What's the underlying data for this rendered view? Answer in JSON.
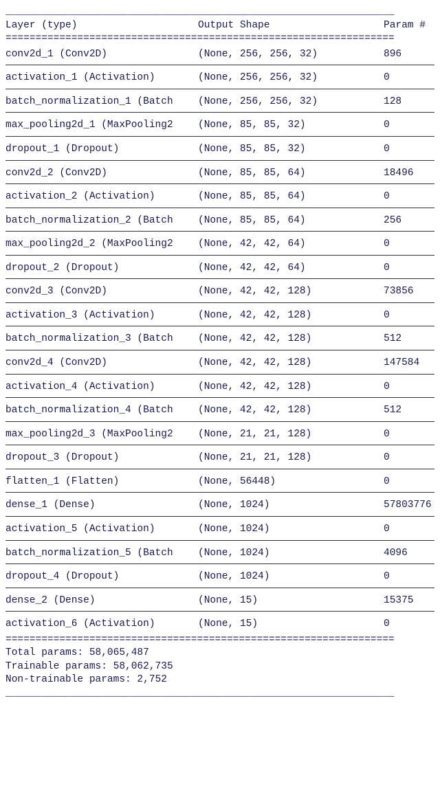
{
  "header": {
    "layer": "Layer (type)",
    "shape": "Output Shape",
    "param": "Param #"
  },
  "divider_eq": "=================================================================",
  "divider_us": "_________________________________________________________________",
  "layers": [
    {
      "layer": "conv2d_1 (Conv2D)",
      "shape": "(None, 256, 256, 32)",
      "param": "896"
    },
    {
      "layer": "activation_1 (Activation)",
      "shape": "(None, 256, 256, 32)",
      "param": "0"
    },
    {
      "layer": "batch_normalization_1 (Batch",
      "shape": "(None, 256, 256, 32)",
      "param": "128"
    },
    {
      "layer": "max_pooling2d_1 (MaxPooling2",
      "shape": "(None, 85, 85, 32)",
      "param": "0"
    },
    {
      "layer": "dropout_1 (Dropout)",
      "shape": "(None, 85, 85, 32)",
      "param": "0"
    },
    {
      "layer": "conv2d_2 (Conv2D)",
      "shape": "(None, 85, 85, 64)",
      "param": "18496"
    },
    {
      "layer": "activation_2 (Activation)",
      "shape": "(None, 85, 85, 64)",
      "param": "0"
    },
    {
      "layer": "batch_normalization_2 (Batch",
      "shape": "(None, 85, 85, 64)",
      "param": "256"
    },
    {
      "layer": "max_pooling2d_2 (MaxPooling2",
      "shape": "(None, 42, 42, 64)",
      "param": "0"
    },
    {
      "layer": "dropout_2 (Dropout)",
      "shape": "(None, 42, 42, 64)",
      "param": "0"
    },
    {
      "layer": "conv2d_3 (Conv2D)",
      "shape": "(None, 42, 42, 128)",
      "param": "73856"
    },
    {
      "layer": "activation_3 (Activation)",
      "shape": "(None, 42, 42, 128)",
      "param": "0"
    },
    {
      "layer": "batch_normalization_3 (Batch",
      "shape": "(None, 42, 42, 128)",
      "param": "512"
    },
    {
      "layer": "conv2d_4 (Conv2D)",
      "shape": "(None, 42, 42, 128)",
      "param": "147584"
    },
    {
      "layer": "activation_4 (Activation)",
      "shape": "(None, 42, 42, 128)",
      "param": "0"
    },
    {
      "layer": "batch_normalization_4 (Batch",
      "shape": "(None, 42, 42, 128)",
      "param": "512"
    },
    {
      "layer": "max_pooling2d_3 (MaxPooling2",
      "shape": "(None, 21, 21, 128)",
      "param": "0"
    },
    {
      "layer": "dropout_3 (Dropout)",
      "shape": "(None, 21, 21, 128)",
      "param": "0"
    },
    {
      "layer": "flatten_1 (Flatten)",
      "shape": "(None, 56448)",
      "param": "0"
    },
    {
      "layer": "dense_1 (Dense)",
      "shape": "(None, 1024)",
      "param": "57803776"
    },
    {
      "layer": "activation_5 (Activation)",
      "shape": "(None, 1024)",
      "param": "0"
    },
    {
      "layer": "batch_normalization_5 (Batch",
      "shape": "(None, 1024)",
      "param": "4096"
    },
    {
      "layer": "dropout_4 (Dropout)",
      "shape": "(None, 1024)",
      "param": "0"
    },
    {
      "layer": "dense_2 (Dense)",
      "shape": "(None, 15)",
      "param": "15375"
    },
    {
      "layer": "activation_6 (Activation)",
      "shape": "(None, 15)",
      "param": "0"
    }
  ],
  "footer": {
    "total": "Total params: 58,065,487",
    "trainable": "Trainable params: 58,062,735",
    "nontrainable": "Non-trainable params: 2,752"
  }
}
